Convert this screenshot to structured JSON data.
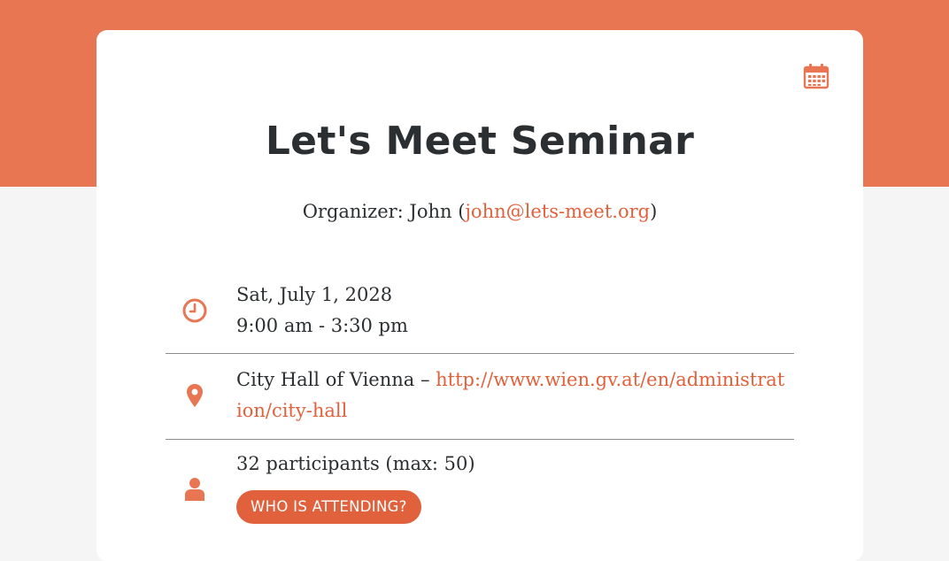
{
  "event": {
    "title": "Let's Meet Seminar",
    "organizer_label": "Organizer:  John (",
    "organizer_email": "john@lets-meet.org",
    "organizer_close": ")",
    "date": "Sat, July 1, 2028",
    "time": "9:00 am -  3:30 pm",
    "venue": "City Hall of Vienna – ",
    "venue_url": "http://www.wien.gv.at/en/administration/city-hall",
    "participants": "32 participants (max: 50)",
    "attending_button": "WHO IS ATTENDING?"
  },
  "icons": {
    "calendar": "calendar-icon",
    "clock": "clock-icon",
    "location": "map-pin-icon",
    "person": "person-icon"
  },
  "colors": {
    "accent": "#e97653",
    "link": "#e0613c",
    "text": "#2b2f31",
    "background": "#f5f5f5"
  }
}
